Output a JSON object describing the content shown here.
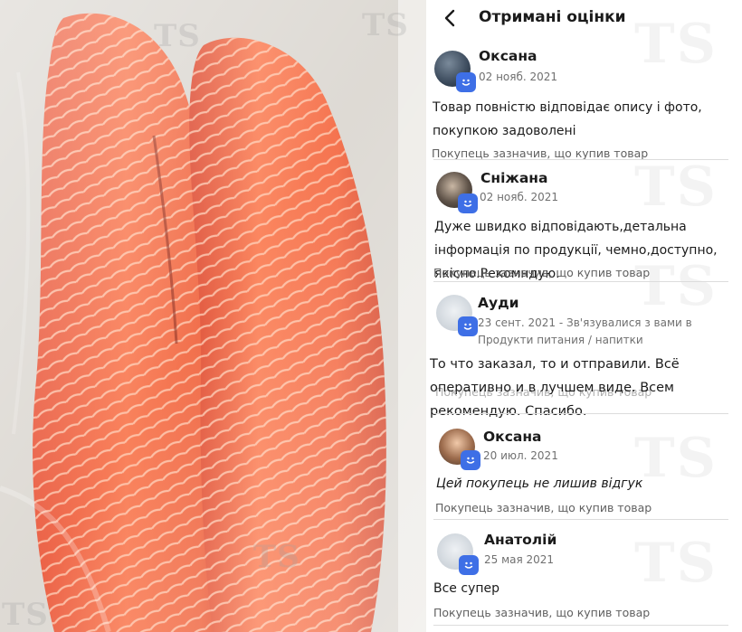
{
  "photo": {
    "watermark": "TS"
  },
  "header": {
    "title": "Отримані оцінки",
    "back_icon": "chevron-left-icon"
  },
  "colors": {
    "badge": "#3e6fe6",
    "accent": "#3e6fe6"
  },
  "reviews": [
    {
      "name": "Оксана",
      "meta": "02 нояб. 2021",
      "text": "Товар повністю відповідає опису і фото, покупкою задоволені",
      "note": "Покупець зазначив, що купив товар"
    },
    {
      "name": "Сніжана",
      "meta": "02 нояб. 2021",
      "text": "Дуже швидко відповідають,детальна інформація по продукції, чемно,доступно, якісно.Рекомндую.",
      "note": "Покупець зазначив, що купив товар"
    },
    {
      "name": "Ауди",
      "meta_date": "23 сент. 2021",
      "meta_rest": " - Зв'язувалися з вами в Продукти питания / напитки",
      "text": "То что заказал, то и отправили. Всё оперативно и в лучшем виде. Всем рекомендую. Спасибо.",
      "note": "Покупець зазначив, що купив товар"
    },
    {
      "name": "Оксана",
      "meta": "20 июл. 2021",
      "text": "Цей покупець не лишив відгук",
      "note": "Покупець зазначив, що купив товар"
    },
    {
      "name": "Анатолій",
      "meta": "25 мая 2021",
      "text": "Все супер",
      "note": "Покупець зазначив, що купив товар"
    }
  ],
  "panel_watermark": "TS"
}
